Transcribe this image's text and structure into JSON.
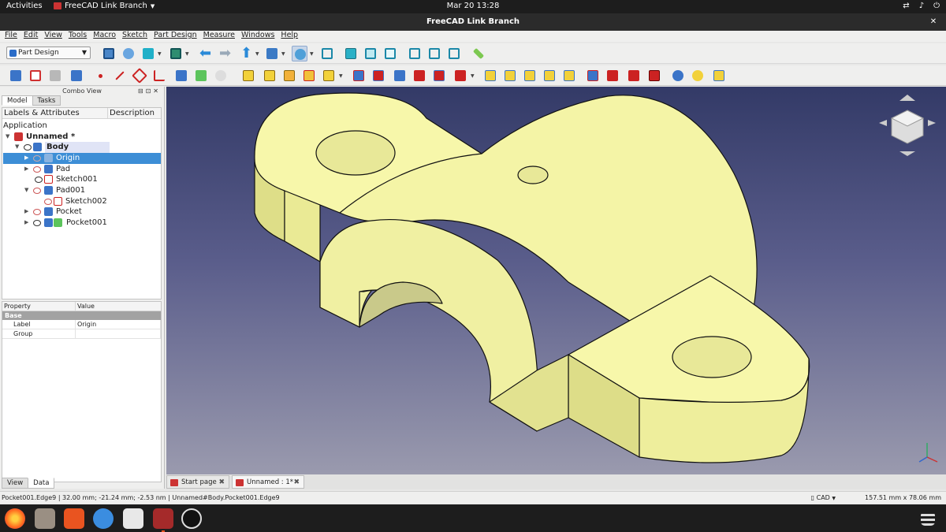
{
  "gnome_bar": {
    "activities": "Activities",
    "app_menu": "FreeCAD Link Branch",
    "clock": "Mar 20  13:28"
  },
  "window": {
    "title": "FreeCAD Link Branch"
  },
  "menus": [
    "File",
    "Edit",
    "View",
    "Tools",
    "Macro",
    "Sketch",
    "Part Design",
    "Measure",
    "Windows",
    "Help"
  ],
  "workbench_selector": {
    "value": "Part Design"
  },
  "combo_view": {
    "title": "Combo View",
    "tabs": [
      "Model",
      "Tasks"
    ],
    "tree_headers": [
      "Labels & Attributes",
      "Description"
    ],
    "tree": [
      {
        "label": "Application"
      },
      {
        "label": "Unnamed *"
      },
      {
        "label": "Body"
      },
      {
        "label": "Origin"
      },
      {
        "label": "Pad"
      },
      {
        "label": "Sketch001"
      },
      {
        "label": "Pad001"
      },
      {
        "label": "Sketch002"
      },
      {
        "label": "Pocket"
      },
      {
        "label": "Pocket001"
      }
    ],
    "property_headers": [
      "Property",
      "Value"
    ],
    "property_group": "Base",
    "properties": [
      {
        "name": "Label",
        "value": "Origin"
      },
      {
        "name": "Group",
        "value": ""
      }
    ],
    "bottom_tabs": [
      "View",
      "Data"
    ]
  },
  "document_tabs": [
    {
      "label": "Start page"
    },
    {
      "label": "Unnamed : 1*"
    }
  ],
  "status": {
    "left": "Pocket001.Edge9 | 32.00 mm; -21.24 mm; -2.53 nm | Unnamed#Body.Pocket001.Edge9",
    "navigation": "CAD",
    "dimensions": "157.51 mm x 78.06 mm"
  },
  "colors": {
    "part_face": "#f7f7aa",
    "part_shade": "#d6d68a",
    "selection": "#3d8ed6",
    "accent": "#e95420"
  }
}
